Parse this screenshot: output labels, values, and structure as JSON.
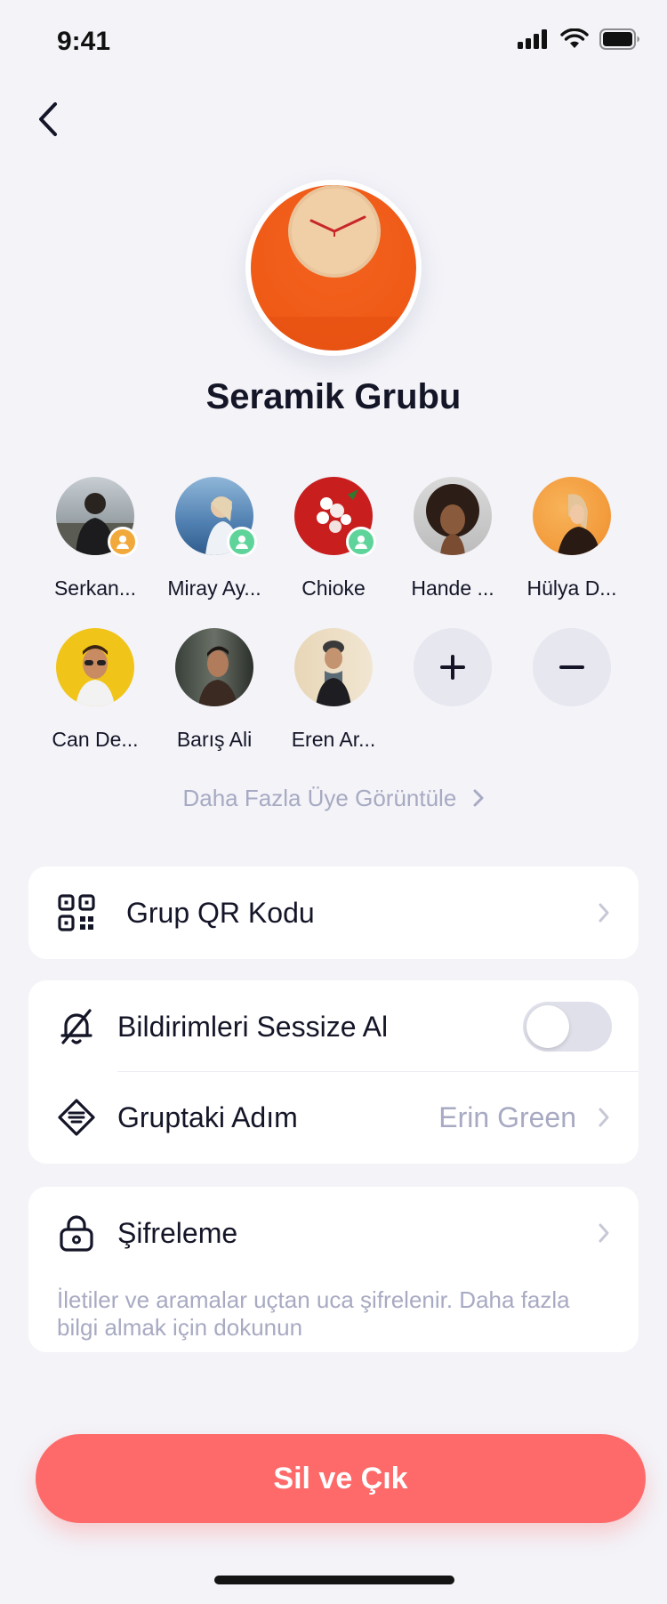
{
  "status_bar": {
    "time": "9:41"
  },
  "group": {
    "name": "Seramik Grubu"
  },
  "members": [
    {
      "name": "Serkan...",
      "badge": "gold"
    },
    {
      "name": "Miray Ay...",
      "badge": "green"
    },
    {
      "name": "Chioke",
      "badge": "green"
    },
    {
      "name": "Hande ...",
      "badge": ""
    },
    {
      "name": "Hülya D...",
      "badge": ""
    },
    {
      "name": "Can De...",
      "badge": ""
    },
    {
      "name": "Barış Ali",
      "badge": ""
    },
    {
      "name": "Eren Ar...",
      "badge": ""
    }
  ],
  "actions": {
    "add_icon": "plus-icon",
    "remove_icon": "minus-icon"
  },
  "more_members": {
    "label": "Daha Fazla Üye Görüntüle"
  },
  "qr": {
    "label": "Grup QR Kodu"
  },
  "mute": {
    "label": "Bildirimleri Sessize Al",
    "enabled": false
  },
  "nickname": {
    "label": "Gruptaki Adım",
    "value": "Erin Green"
  },
  "encryption": {
    "label": "Şifreleme",
    "description": " İletiler ve aramalar uçtan uca şifrelenir. Daha fazla bilgi almak için dokunun"
  },
  "leave": {
    "label": "Sil ve Çık"
  },
  "colors": {
    "background": "#f3f3f8",
    "accent_red": "#fe6a6a",
    "muted_text": "#a7aac2",
    "badge_gold": "#f2a93b",
    "badge_green": "#5fd49a"
  }
}
